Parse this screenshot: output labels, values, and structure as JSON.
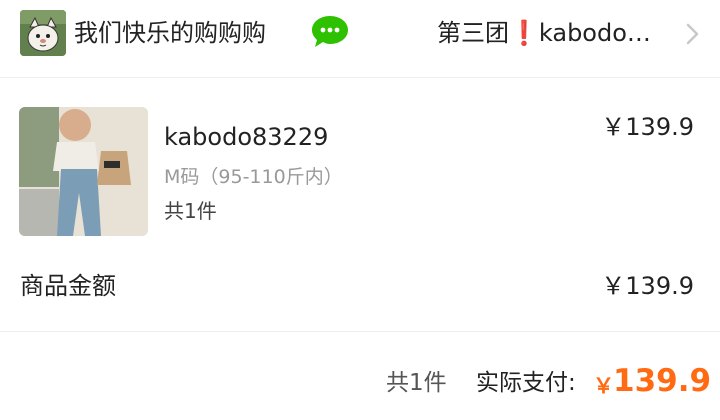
{
  "header": {
    "shop_name": "我们快乐的购购购",
    "group_label": "第三团❗kabodo…",
    "icons": {
      "avatar": "cartoon-avatar",
      "chat": "wechat-icon",
      "chevron": "chevron-right-icon"
    }
  },
  "product": {
    "title": "kabodo83229",
    "spec": "M码（95-110斤内）",
    "quantity": "共1件",
    "price": "￥139.9",
    "image": "product-photo-jeans"
  },
  "amount": {
    "label": "商品金额",
    "value": "￥139.9"
  },
  "summary": {
    "count": "共1件",
    "paid_label": "实际支付:",
    "currency": "￥",
    "total": "139.9"
  },
  "colors": {
    "accent": "#ff6a13",
    "wechat": "#2dc100",
    "divider": "#eeeeee",
    "muted_text": "#999999"
  }
}
